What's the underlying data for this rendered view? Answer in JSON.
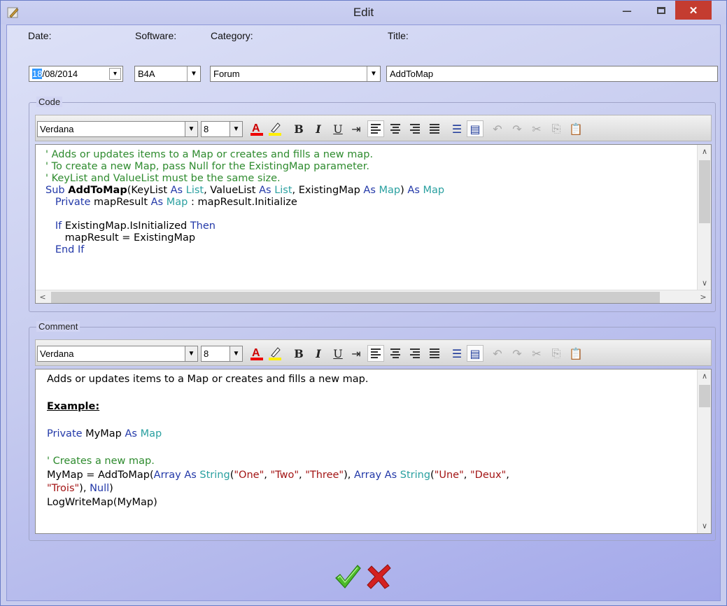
{
  "window": {
    "title": "Edit",
    "minimize": "–",
    "close": "✕"
  },
  "fields": {
    "date_label": "Date:",
    "date_day": "18",
    "date_rest": "/08/2014",
    "software_label": "Software:",
    "software_value": "B4A",
    "category_label": "Category:",
    "category_value": "Forum",
    "title_label": "Title:",
    "title_value": "AddToMap"
  },
  "code_group": {
    "label": "Code"
  },
  "comment_group": {
    "label": "Comment"
  },
  "toolbar": {
    "font": "Verdana",
    "size": "8",
    "bold": "B",
    "italic": "I",
    "underline": "U",
    "indent": "⇥"
  },
  "code_lines": [
    [
      [
        "c",
        "' Adds or updates items to a Map or creates and fills a new map."
      ]
    ],
    [
      [
        "c",
        "' To create a new Map, pass Null for the ExistingMap parameter."
      ]
    ],
    [
      [
        "c",
        "' KeyList and ValueList must be the same size."
      ]
    ],
    [
      [
        "k",
        "Sub "
      ],
      [
        "b",
        "AddToMap"
      ],
      [
        "n",
        "(KeyList "
      ],
      [
        "k",
        "As "
      ],
      [
        "t",
        "List"
      ],
      [
        "n",
        ", ValueList "
      ],
      [
        "k",
        "As "
      ],
      [
        "t",
        "List"
      ],
      [
        "n",
        ", ExistingMap "
      ],
      [
        "k",
        "As "
      ],
      [
        "t",
        "Map"
      ],
      [
        "n",
        ") "
      ],
      [
        "k",
        "As "
      ],
      [
        "t",
        "Map"
      ]
    ],
    [
      [
        "k",
        "   Private "
      ],
      [
        "n",
        "mapResult "
      ],
      [
        "k",
        "As "
      ],
      [
        "t",
        "Map"
      ],
      [
        "n",
        " : mapResult.Initialize"
      ]
    ],
    [
      [
        "n",
        ""
      ]
    ],
    [
      [
        "k",
        "   If "
      ],
      [
        "n",
        "ExistingMap.IsInitialized "
      ],
      [
        "k",
        "Then"
      ]
    ],
    [
      [
        "n",
        "      mapResult = ExistingMap"
      ]
    ],
    [
      [
        "k",
        "   End If"
      ]
    ]
  ],
  "comment_lines": [
    [
      [
        "n",
        "Adds or updates items to a Map or creates and fills a new map."
      ]
    ],
    [
      [
        "n",
        ""
      ]
    ],
    [
      [
        "u",
        "Example:"
      ]
    ],
    [
      [
        "n",
        ""
      ]
    ],
    [
      [
        "k",
        "Private "
      ],
      [
        "n",
        "MyMap "
      ],
      [
        "k",
        "As "
      ],
      [
        "t",
        "Map"
      ]
    ],
    [
      [
        "n",
        ""
      ]
    ],
    [
      [
        "c",
        "' Creates a new map."
      ]
    ],
    [
      [
        "n",
        "MyMap = AddToMap("
      ],
      [
        "k",
        "Array "
      ],
      [
        "k",
        "As "
      ],
      [
        "t",
        "String"
      ],
      [
        "n",
        "("
      ],
      [
        "s",
        "\"One\""
      ],
      [
        "n",
        ", "
      ],
      [
        "s",
        "\"Two\""
      ],
      [
        "n",
        ", "
      ],
      [
        "s",
        "\"Three\""
      ],
      [
        "n",
        "), "
      ],
      [
        "k",
        "Array "
      ],
      [
        "k",
        "As "
      ],
      [
        "t",
        "String"
      ],
      [
        "n",
        "("
      ],
      [
        "s",
        "\"Une\""
      ],
      [
        "n",
        ", "
      ],
      [
        "s",
        "\"Deux\""
      ],
      [
        "n",
        ","
      ]
    ],
    [
      [
        "s",
        "\"Trois\""
      ],
      [
        "n",
        "), "
      ],
      [
        "k",
        "Null"
      ],
      [
        "n",
        ")"
      ]
    ],
    [
      [
        "n",
        "LogWriteMap(MyMap)"
      ]
    ]
  ],
  "colors": {
    "comment": "#2e8b2e",
    "keyword": "#2238a8",
    "type": "#2aa0a0",
    "string": "#a31515",
    "close_button": "#c43c30",
    "ok": "#4cbb2a",
    "cancel": "#d42020"
  }
}
